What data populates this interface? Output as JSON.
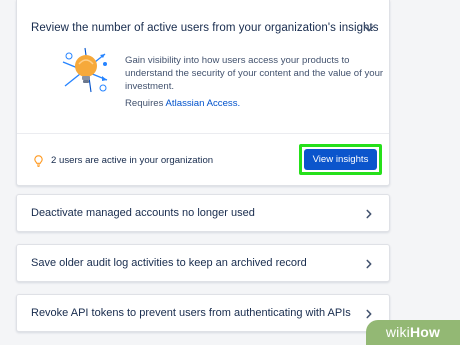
{
  "insights_card": {
    "title": "Review the number of active users from your organization's insights",
    "description": "Gain visibility into how users access your products to understand the security of your content and the value of your investment.",
    "requires_prefix": "Requires ",
    "requires_link": "Atlassian Access.",
    "active_users_text": "2 users are active in your organization",
    "view_button_label": "View insights"
  },
  "tasks": [
    {
      "label": "Deactivate managed accounts no longer used"
    },
    {
      "label": "Save older audit log activities to keep an archived record"
    },
    {
      "label": "Revoke API tokens to prevent users from authenticating with APIs"
    }
  ],
  "watermark": {
    "wiki": "wiki",
    "how": "How"
  },
  "colors": {
    "primary_button": "#0b55cc",
    "highlight": "#26e01a",
    "link": "#0052cc",
    "bulb": "#ff991f",
    "watermark_bg": "#93b874"
  },
  "icons": {
    "collapse": "chevron-down-icon",
    "row_arrow": "chevron-right-icon",
    "lightbulb": "lightbulb-icon",
    "illustration": "insights-lightbulb-illustration"
  }
}
